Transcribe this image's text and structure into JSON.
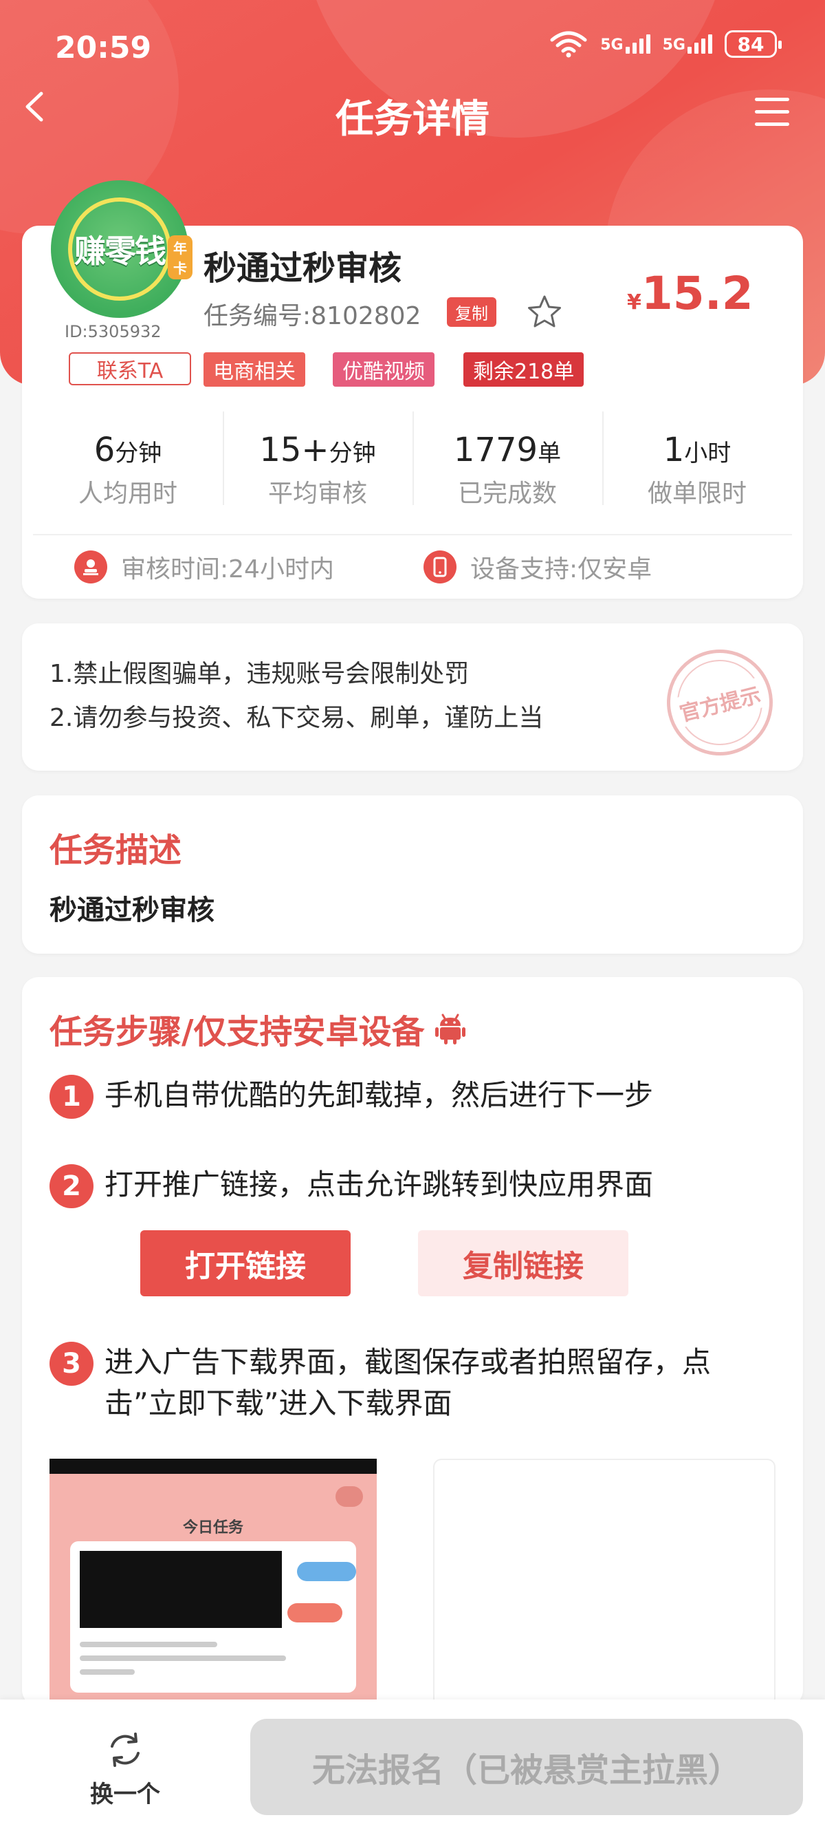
{
  "status_bar": {
    "time": "20:59",
    "network1": "5G",
    "network2": "5G",
    "battery": "84"
  },
  "header": {
    "title": "任务详情"
  },
  "task": {
    "avatar_text": "赚零钱",
    "avatar_badge": "年卡",
    "user_id": "ID:5305932",
    "contact_label": "联系TA",
    "name": "秒通过秒审核",
    "number": "任务编号:8102802",
    "copy_label": "复制",
    "price_currency": "¥",
    "price": "15.2",
    "tags": [
      "电商相关",
      "优酷视频",
      "剩余218单"
    ],
    "stats": [
      {
        "value": "6",
        "unit": "分钟",
        "label": "人均用时"
      },
      {
        "value": "15+",
        "unit": "分钟",
        "label": "平均审核"
      },
      {
        "value": "1779",
        "unit": "单",
        "label": "已完成数"
      },
      {
        "value": "1",
        "unit": "小时",
        "label": "做单限时"
      }
    ],
    "review_time": "审核时间:24小时内",
    "device_support": "设备支持:仅安卓"
  },
  "notice": {
    "lines": [
      "1.禁止假图骗单，违规账号会限制处罚",
      "2.请勿参与投资、私下交易、刷单，谨防上当"
    ],
    "stamp": "官方提示"
  },
  "description": {
    "title": "任务描述",
    "text": "秒通过秒审核"
  },
  "steps": {
    "title": "任务步骤/仅支持安卓设备",
    "items": [
      {
        "num": "1",
        "text": "手机自带优酷的先卸载掉，然后进行下一步"
      },
      {
        "num": "2",
        "text": "打开推广链接，点击允许跳转到快应用界面"
      },
      {
        "num": "3",
        "text": "进入广告下载界面，截图保存或者拍照留存，点击”立即下载”进入下载界面"
      }
    ],
    "open_link": "打开链接",
    "copy_link": "复制链接",
    "thumb_title": "今日任务"
  },
  "bottom": {
    "switch_label": "换一个",
    "signup_label": "无法报名（已被悬赏主拉黑）"
  },
  "colors": {
    "accent": "#e8504b",
    "hero": "#ee524c",
    "disabled": "#dcdcdc"
  }
}
